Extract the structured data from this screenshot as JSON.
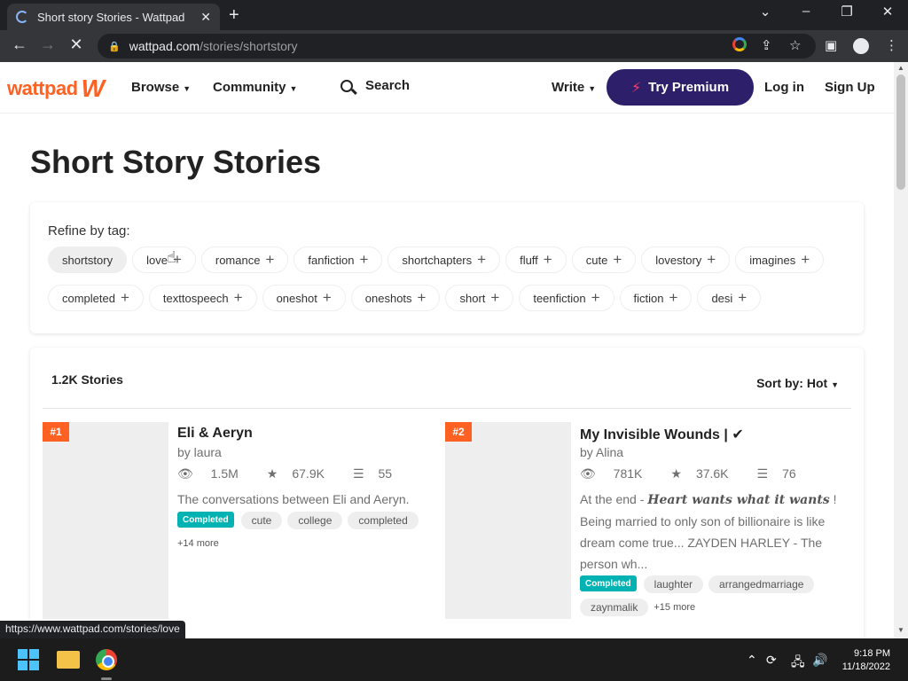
{
  "browser": {
    "tab_title": "Short story Stories - Wattpad",
    "close_glyph": "✕",
    "new_tab_glyph": "+",
    "url_domain": "wattpad.com",
    "url_path": "/stories/shortstory",
    "status_url": "https://www.wattpad.com/stories/love"
  },
  "header": {
    "logo": "wattpad",
    "browse": "Browse",
    "community": "Community",
    "search": "Search",
    "write": "Write",
    "premium": "Try Premium",
    "login": "Log in",
    "signup": "Sign Up"
  },
  "page": {
    "title": "Short Story Stories",
    "refine_label": "Refine by tag:",
    "tags_row1": [
      "shortstory",
      "love",
      "romance",
      "fanfiction",
      "shortchapters",
      "fluff",
      "cute",
      "lovestory",
      "imagines"
    ],
    "tags_row2": [
      "completed",
      "texttospeech",
      "oneshot",
      "oneshots",
      "short",
      "teenfiction",
      "fiction",
      "desi"
    ],
    "selected_tag": "shortstory",
    "story_count": "1.2K Stories",
    "sort_label": "Sort by: Hot"
  },
  "stories": [
    {
      "rank": "#1",
      "title": "Eli & Aeryn",
      "author": "by laura",
      "reads": "1.5M",
      "votes": "67.9K",
      "parts": "55",
      "description": "The conversations between Eli and Aeryn.",
      "completed_label": "Completed",
      "tags": [
        "cute",
        "college",
        "completed"
      ],
      "more": "+14 more"
    },
    {
      "rank": "#2",
      "title": "My Invisible Wounds | ✔",
      "author": "by Alina",
      "reads": "781K",
      "votes": "37.6K",
      "parts": "76",
      "description_pre": "At the end - ",
      "description_em": "Heart wants what it wants",
      "description_post": " ! Being married to only son of billionaire is like dream come true... ZAYDEN HARLEY - The person wh...",
      "completed_label": "Completed",
      "tags": [
        "laughter",
        "arrangedmarriage",
        "zaynmalik"
      ],
      "more": "+15 more"
    }
  ],
  "taskbar": {
    "time": "9:18 PM",
    "date": "11/18/2022"
  },
  "colors": {
    "brand": "#ff6122",
    "premium_bg": "#2e1f6b",
    "completed": "#00b2b2"
  }
}
